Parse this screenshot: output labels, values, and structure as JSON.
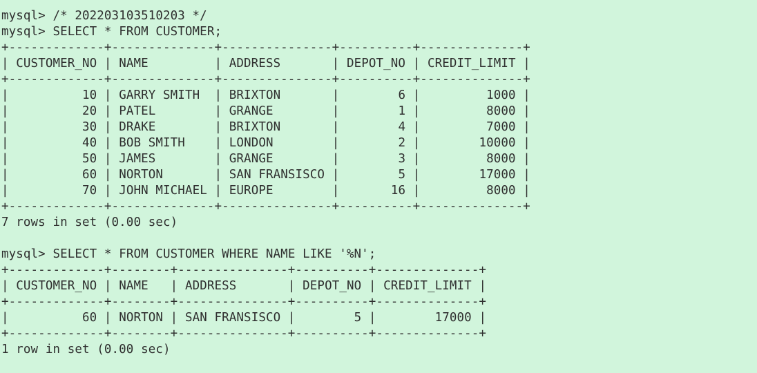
{
  "terminal": {
    "prompt": "mysql>",
    "comment": "/* 202203103510203 */",
    "query1": "SELECT * FROM CUSTOMER;",
    "query2": "SELECT * FROM CUSTOMER WHERE NAME LIKE '%N';",
    "result1_footer": "7 rows in set (0.00 sec)",
    "result2_footer": "1 row in set (0.00 sec)"
  },
  "table1": {
    "columns": [
      "CUSTOMER_NO",
      "NAME",
      "ADDRESS",
      "DEPOT_NO",
      "CREDIT_LIMIT"
    ],
    "rows": [
      [
        "10",
        "GARRY SMITH",
        "BRIXTON",
        "6",
        "1000"
      ],
      [
        "20",
        "PATEL",
        "GRANGE",
        "1",
        "8000"
      ],
      [
        "30",
        "DRAKE",
        "BRIXTON",
        "4",
        "7000"
      ],
      [
        "40",
        "BOB SMITH",
        "LONDON",
        "2",
        "10000"
      ],
      [
        "50",
        "JAMES",
        "GRANGE",
        "3",
        "8000"
      ],
      [
        "60",
        "NORTON",
        "SAN FRANSISCO",
        "5",
        "17000"
      ],
      [
        "70",
        "JOHN MICHAEL",
        "EUROPE",
        "16",
        "8000"
      ]
    ]
  },
  "table2": {
    "columns": [
      "CUSTOMER_NO",
      "NAME",
      "ADDRESS",
      "DEPOT_NO",
      "CREDIT_LIMIT"
    ],
    "rows": [
      [
        "60",
        "NORTON",
        "SAN FRANSISCO",
        "5",
        "17000"
      ]
    ]
  }
}
